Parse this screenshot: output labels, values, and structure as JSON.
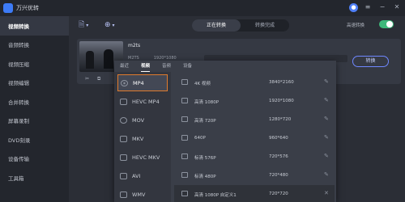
{
  "app": {
    "title": "万兴优转"
  },
  "titlebar_icons": [
    "user-icon",
    "menu-icon",
    "minimize-icon",
    "close-icon"
  ],
  "sidebar": {
    "items": [
      {
        "label": "视频转换",
        "active": true
      },
      {
        "label": "音频转换"
      },
      {
        "label": "视频压缩"
      },
      {
        "label": "视频编辑"
      },
      {
        "label": "合并转换"
      },
      {
        "label": "屏幕录制"
      },
      {
        "label": "DVD刻录"
      },
      {
        "label": "设备传输"
      },
      {
        "label": "工具箱"
      }
    ]
  },
  "toolbar": {
    "tabs": [
      {
        "label": "正在转换",
        "active": true
      },
      {
        "label": "转换完成"
      }
    ],
    "high_speed_label": "高速转换",
    "high_speed_on": true
  },
  "file": {
    "name": "m2ts",
    "meta": [
      "M2TS",
      "1920*1080"
    ],
    "convert_label": "转换"
  },
  "format_dropdown": {
    "tabs": [
      {
        "label": "最近"
      },
      {
        "label": "视频",
        "active": true
      },
      {
        "label": "音频"
      },
      {
        "label": "设备"
      }
    ],
    "formats": [
      {
        "label": "MP4",
        "selected": true
      },
      {
        "label": "HEVC MP4"
      },
      {
        "label": "MOV"
      },
      {
        "label": "MKV"
      },
      {
        "label": "HEVC MKV"
      },
      {
        "label": "AVI"
      },
      {
        "label": "WMV"
      }
    ],
    "resolutions": [
      {
        "name": "4K 视频",
        "size": "3840*2160"
      },
      {
        "name": "高清 1080P",
        "size": "1920*1080"
      },
      {
        "name": "高清 720P",
        "size": "1280*720"
      },
      {
        "name": "640P",
        "size": "960*640"
      },
      {
        "name": "标清 576P",
        "size": "720*576"
      },
      {
        "name": "标清 480P",
        "size": "720*480"
      },
      {
        "name": "高清 1080P 自定义1",
        "size": "720*720",
        "custom": true
      }
    ]
  }
}
